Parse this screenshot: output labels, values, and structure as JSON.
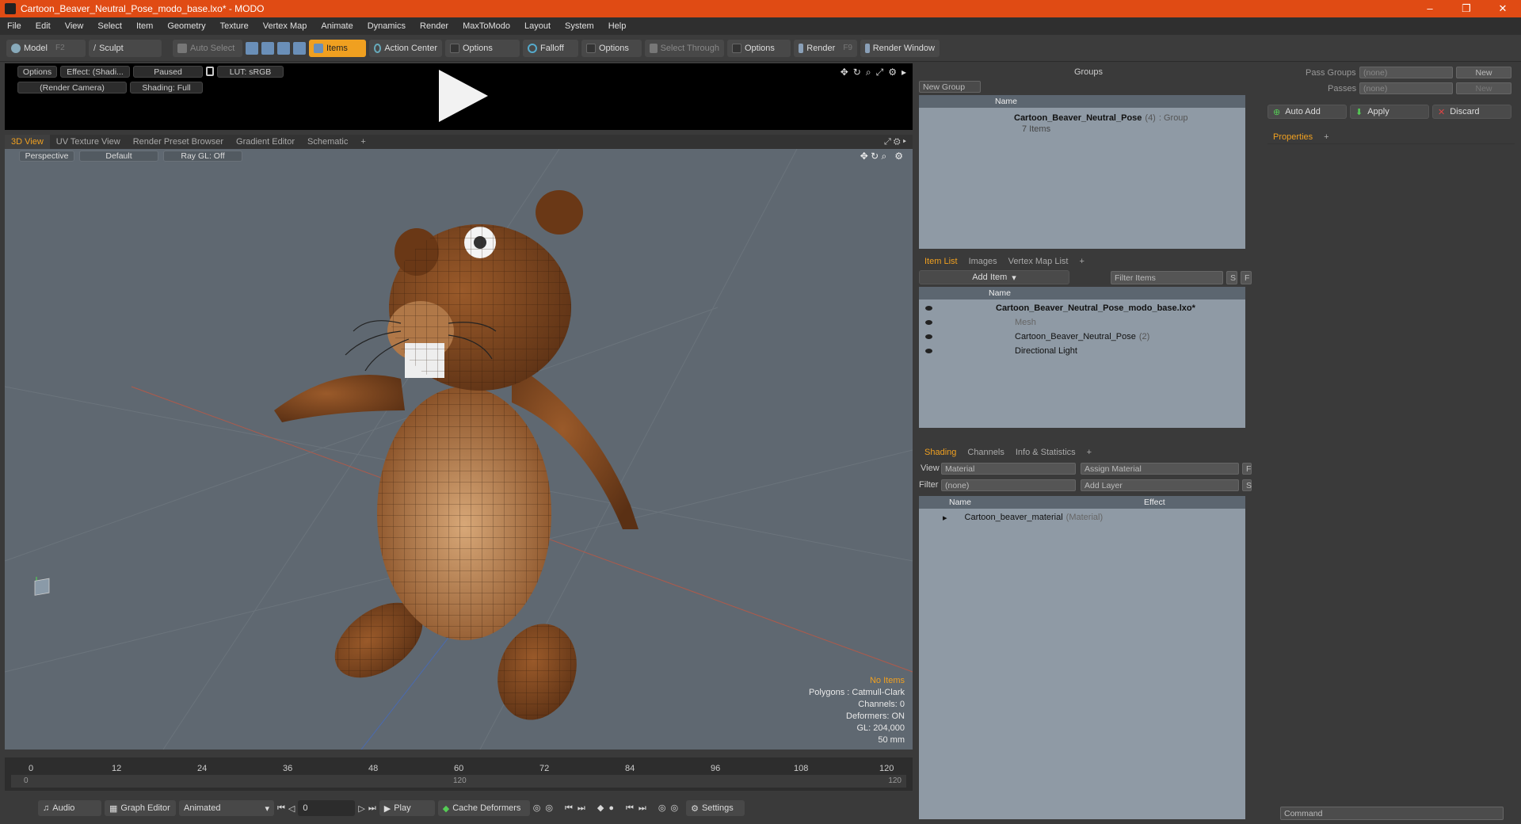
{
  "window": {
    "title": "Cartoon_Beaver_Neutral_Pose_modo_base.lxo* - MODO",
    "minimize": "–",
    "maximize": "❐",
    "close": "✕"
  },
  "menu": [
    "File",
    "Edit",
    "View",
    "Select",
    "Item",
    "Geometry",
    "Texture",
    "Vertex Map",
    "Animate",
    "Dynamics",
    "Render",
    "MaxToModo",
    "Layout",
    "System",
    "Help"
  ],
  "toolbar": {
    "model": "Model",
    "model_key": "F2",
    "sculpt": "Sculpt",
    "auto_select": "Auto Select",
    "items": "Items",
    "action_center": "Action Center",
    "options1": "Options",
    "falloff": "Falloff",
    "options2": "Options",
    "select_through": "Select Through",
    "options3": "Options",
    "render": "Render",
    "render_key": "F9",
    "render_window": "Render Window"
  },
  "preview": {
    "options": "Options",
    "effect": "Effect: (Shadi...",
    "paused": "Paused",
    "lut": "LUT: sRGB",
    "camera": "(Render Camera)",
    "shading": "Shading: Full"
  },
  "viewport_tabs": [
    "3D View",
    "UV Texture View",
    "Render Preset Browser",
    "Gradient Editor",
    "Schematic",
    "+"
  ],
  "viewport": {
    "perspective": "Perspective",
    "default": "Default",
    "raygl": "Ray GL: Off",
    "stats": {
      "items": "No Items",
      "polygons": "Polygons : Catmull-Clark",
      "channels": "Channels: 0",
      "deformers": "Deformers: ON",
      "gl": "GL: 204,000",
      "mm": "50 mm"
    }
  },
  "timeline": {
    "ticks": [
      "0",
      "12",
      "24",
      "36",
      "48",
      "60",
      "72",
      "84",
      "96",
      "108",
      "120"
    ],
    "range_start": "0",
    "range_mid": "120",
    "range_end": "120"
  },
  "bottombar": {
    "audio": "Audio",
    "graph_editor": "Graph Editor",
    "animated": "Animated",
    "frame": "0",
    "play": "Play",
    "cache": "Cache Deformers",
    "settings": "Settings"
  },
  "groups": {
    "title": "Groups",
    "new_group": "New Group",
    "col_name": "Name",
    "item_name": "Cartoon_Beaver_Neutral_Pose",
    "item_count": "(4)",
    "item_type": ": Group",
    "item_sub": "7 Items"
  },
  "itemlist": {
    "tabs": [
      "Item List",
      "Images",
      "Vertex Map List",
      "+"
    ],
    "add_item": "Add Item",
    "filter": "Filter Items",
    "s": "S",
    "f": "F",
    "col_name": "Name",
    "rows": [
      {
        "label": "Cartoon_Beaver_Neutral_Pose_modo_base.lxo*",
        "count": ""
      },
      {
        "label": "Mesh",
        "count": ""
      },
      {
        "label": "Cartoon_Beaver_Neutral_Pose",
        "count": "(2)"
      },
      {
        "label": "Directional Light",
        "count": ""
      }
    ]
  },
  "shading": {
    "tabs": [
      "Shading",
      "Channels",
      "Info & Statistics",
      "+"
    ],
    "view_label": "View",
    "view_value": "Material",
    "assign": "Assign Material",
    "f": "F",
    "filter_label": "Filter",
    "filter_value": "(none)",
    "add_layer": "Add Layer",
    "s": "S",
    "col_name": "Name",
    "col_effect": "Effect",
    "row_name": "Cartoon_beaver_material",
    "row_type": "(Material)"
  },
  "passes": {
    "pass_groups": "Pass Groups",
    "passes": "Passes",
    "none1": "(none)",
    "none2": "(none)",
    "new1": "New",
    "new2": "New",
    "auto_add": "Auto Add",
    "apply": "Apply",
    "discard": "Discard",
    "properties": "Properties",
    "plus": "+",
    "command": "Command"
  },
  "colors": {
    "accent": "#f0a020",
    "titlebar": "#e04b14",
    "viewport": "#5f6871",
    "list": "#8f9aa5"
  }
}
